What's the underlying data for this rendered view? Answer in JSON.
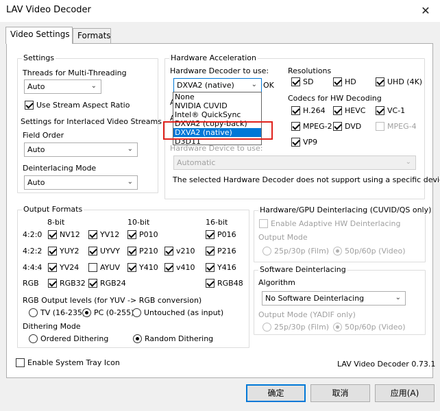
{
  "window": {
    "title": "LAV Video Decoder",
    "close_glyph": "✕"
  },
  "tabs": [
    {
      "label": "Video Settings",
      "active": true
    },
    {
      "label": "Formats",
      "active": false
    }
  ],
  "settings": {
    "group_title": "Settings",
    "threads_label": "Threads for Multi-Threading",
    "threads_value": "Auto",
    "stream_aspect_label": "Use Stream Aspect Ratio",
    "stream_aspect_checked": true,
    "interlaced_title": "Settings for Interlaced Video Streams",
    "field_order_label": "Field Order",
    "field_order_value": "Auto",
    "deinterlacing_mode_label": "Deinterlacing Mode",
    "deinterlacing_mode_value": "Auto"
  },
  "hardware": {
    "group_title": "Hardware Acceleration",
    "decoder_label": "Hardware Decoder to use:",
    "decoder_value": "DXVA2 (native)",
    "ok_text": "OK",
    "hidden_label_a": "A",
    "hidden_label_b": "A",
    "hidden_label_r": "r:",
    "dropdown_options": [
      "None",
      "NVIDIA CUVID",
      "Intel® QuickSync",
      "DXVA2 (copy-back)",
      "DXVA2 (native)",
      "D3D11"
    ],
    "dropdown_selected": "DXVA2 (native)",
    "device_label": "Hardware Device to use:",
    "device_value": "Automatic",
    "device_note": "The selected Hardware Decoder does not support using a specific device.",
    "resolutions_title": "Resolutions",
    "resolutions": [
      {
        "label": "SD",
        "checked": true
      },
      {
        "label": "HD",
        "checked": true
      },
      {
        "label": "UHD (4K)",
        "checked": true
      }
    ],
    "codecs_title": "Codecs for HW Decoding",
    "codecs": [
      {
        "label": "H.264",
        "checked": true,
        "enabled": true
      },
      {
        "label": "HEVC",
        "checked": true,
        "enabled": true
      },
      {
        "label": "VC-1",
        "checked": true,
        "enabled": true
      },
      {
        "label": "MPEG-2",
        "checked": true,
        "enabled": true
      },
      {
        "label": "DVD",
        "checked": true,
        "enabled": true
      },
      {
        "label": "MPEG-4",
        "checked": false,
        "enabled": false
      },
      {
        "label": "VP9",
        "checked": true,
        "enabled": true
      }
    ]
  },
  "output": {
    "group_title": "Output Formats",
    "col_8bit": "8-bit",
    "col_10bit": "10-bit",
    "col_16bit": "16-bit",
    "row_420": "4:2:0",
    "row_422": "4:2:2",
    "row_444": "4:4:4",
    "row_rgb": "RGB",
    "formats": {
      "nv12": {
        "label": "NV12",
        "checked": true
      },
      "yv12": {
        "label": "YV12",
        "checked": true
      },
      "p010": {
        "label": "P010",
        "checked": true
      },
      "p016": {
        "label": "P016",
        "checked": true
      },
      "yuy2": {
        "label": "YUY2",
        "checked": true
      },
      "uyvy": {
        "label": "UYVY",
        "checked": true
      },
      "p210": {
        "label": "P210",
        "checked": true
      },
      "v210": {
        "label": "v210",
        "checked": true
      },
      "p216": {
        "label": "P216",
        "checked": true
      },
      "yv24": {
        "label": "YV24",
        "checked": true
      },
      "ayuv": {
        "label": "AYUV",
        "checked": false
      },
      "y410": {
        "label": "Y410",
        "checked": true
      },
      "v410": {
        "label": "v410",
        "checked": true
      },
      "y416": {
        "label": "Y416",
        "checked": true
      },
      "rgb32": {
        "label": "RGB32",
        "checked": true
      },
      "rgb24": {
        "label": "RGB24",
        "checked": true
      },
      "rgb48": {
        "label": "RGB48",
        "checked": true
      }
    },
    "rgb_levels_label": "RGB Output levels (for YUV -> RGB conversion)",
    "rgb_levels": [
      {
        "label": "TV (16-235)",
        "checked": false
      },
      {
        "label": "PC (0-255)",
        "checked": true
      },
      {
        "label": "Untouched (as input)",
        "checked": false
      }
    ],
    "dithering_label": "Dithering Mode",
    "dithering": [
      {
        "label": "Ordered Dithering",
        "checked": false
      },
      {
        "label": "Random Dithering",
        "checked": true
      }
    ]
  },
  "hw_deint": {
    "group_title": "Hardware/GPU Deinterlacing (CUVID/QS only)",
    "adaptive_label": "Enable Adaptive HW Deinterlacing",
    "output_mode_label": "Output Mode",
    "film_label": "25p/30p (Film)",
    "video_label": "50p/60p (Video)",
    "video_checked": true
  },
  "sw_deint": {
    "group_title": "Software Deinterlacing",
    "algorithm_label": "Algorithm",
    "algorithm_value": "No Software Deinterlacing",
    "output_mode_label": "Output Mode (YADIF only)",
    "film_label": "25p/30p (Film)",
    "video_label": "50p/60p (Video)",
    "video_checked": true
  },
  "footer": {
    "tray_label": "Enable System Tray Icon",
    "tray_checked": false,
    "version": "LAV Video Decoder 0.73.1"
  },
  "buttons": {
    "ok": "确定",
    "cancel": "取消",
    "apply": "应用(A)"
  },
  "arrow_glyph": "⌄",
  "colors": {
    "accent": "#0078d7",
    "highlight_frame": "#e0221c",
    "dialog_bg": "#f0f0f0"
  }
}
